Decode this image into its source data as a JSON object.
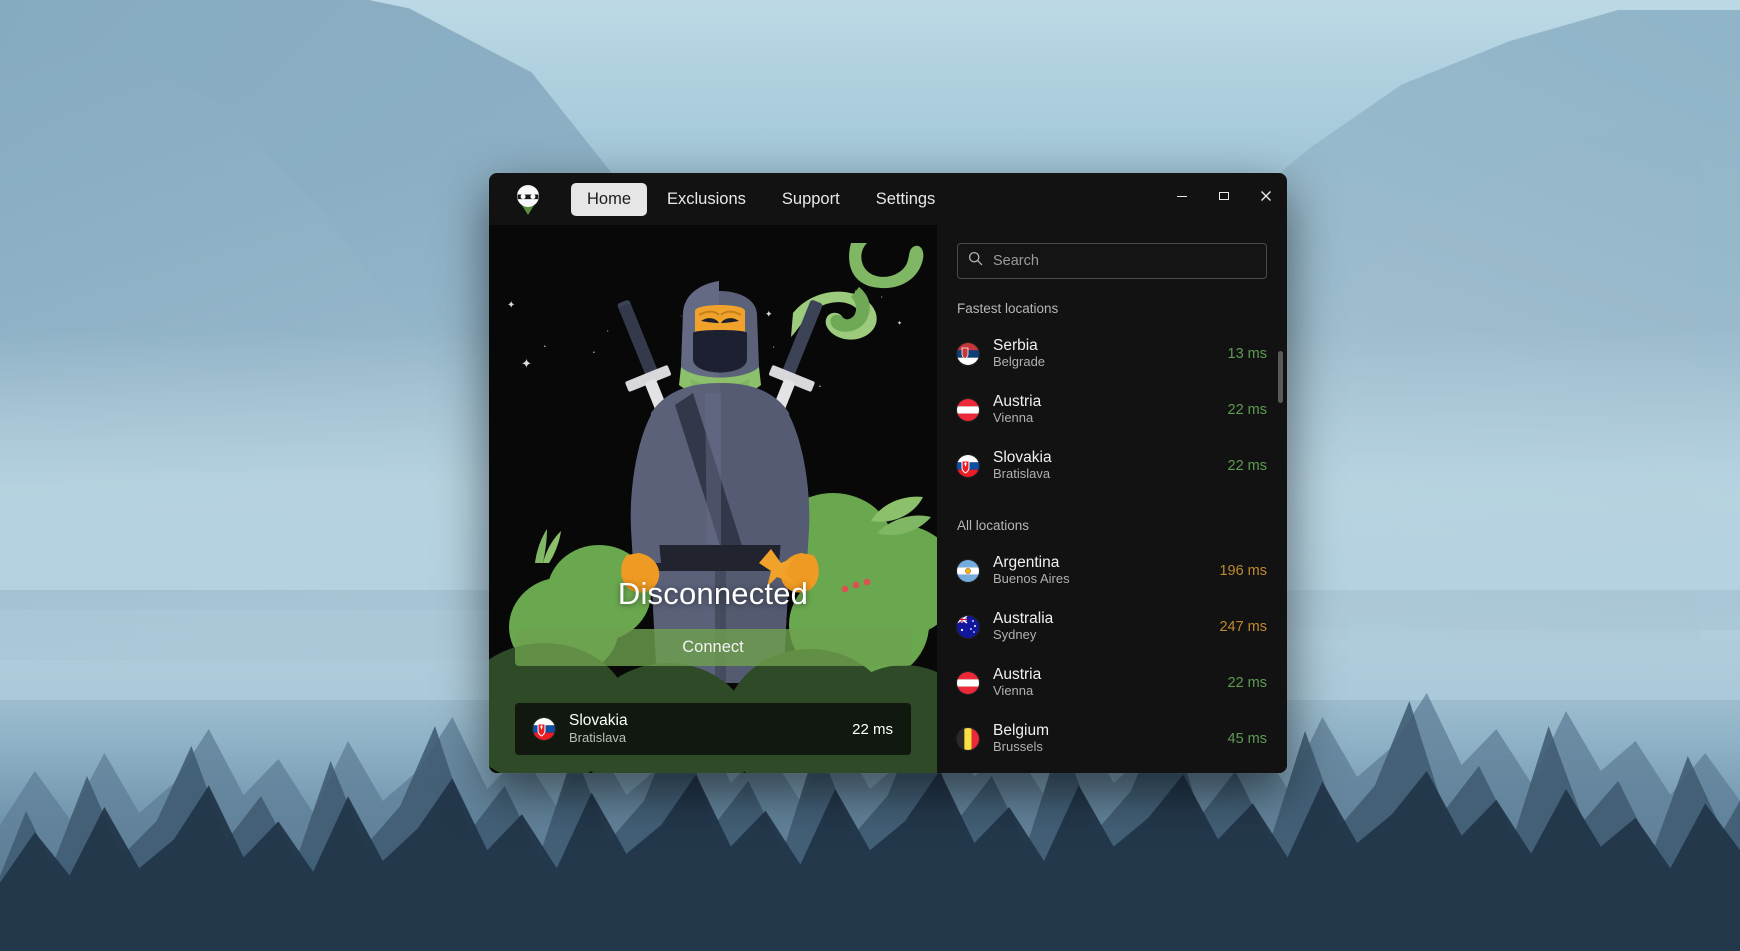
{
  "window": {
    "titlebar": {
      "logo_icon": "ninja-logo-icon",
      "tabs": [
        {
          "label": "Home",
          "active": true
        },
        {
          "label": "Exclusions",
          "active": false
        },
        {
          "label": "Support",
          "active": false
        },
        {
          "label": "Settings",
          "active": false
        }
      ],
      "controls": {
        "minimize": "–",
        "maximize": "❐",
        "close": "✕"
      }
    },
    "hero": {
      "status": "Disconnected",
      "connect_label": "Connect",
      "selected_location": {
        "country": "Slovakia",
        "city": "Bratislava",
        "ping": "22 ms",
        "flag": "sk"
      }
    },
    "panel": {
      "search": {
        "placeholder": "Search",
        "value": "",
        "icon": "search-icon"
      },
      "sections": [
        {
          "title": "Fastest locations",
          "items": [
            {
              "country": "Serbia",
              "city": "Belgrade",
              "ping": "13 ms",
              "ping_level": "good",
              "flag": "rs"
            },
            {
              "country": "Austria",
              "city": "Vienna",
              "ping": "22 ms",
              "ping_level": "good",
              "flag": "at"
            },
            {
              "country": "Slovakia",
              "city": "Bratislava",
              "ping": "22 ms",
              "ping_level": "good",
              "flag": "sk"
            }
          ]
        },
        {
          "title": "All locations",
          "items": [
            {
              "country": "Argentina",
              "city": "Buenos Aires",
              "ping": "196 ms",
              "ping_level": "warn",
              "flag": "ar"
            },
            {
              "country": "Australia",
              "city": "Sydney",
              "ping": "247 ms",
              "ping_level": "warn",
              "flag": "au"
            },
            {
              "country": "Austria",
              "city": "Vienna",
              "ping": "22 ms",
              "ping_level": "good",
              "flag": "at"
            },
            {
              "country": "Belgium",
              "city": "Brussels",
              "ping": "45 ms",
              "ping_level": "good",
              "flag": "be"
            }
          ]
        }
      ]
    }
  },
  "colors": {
    "accent_green": "#6ea04e",
    "ping_good": "#5e9c52",
    "ping_warn": "#c08a2e",
    "window_bg": "#121212",
    "hero_bg": "#080808",
    "active_tab_bg": "#e6e6e6"
  }
}
